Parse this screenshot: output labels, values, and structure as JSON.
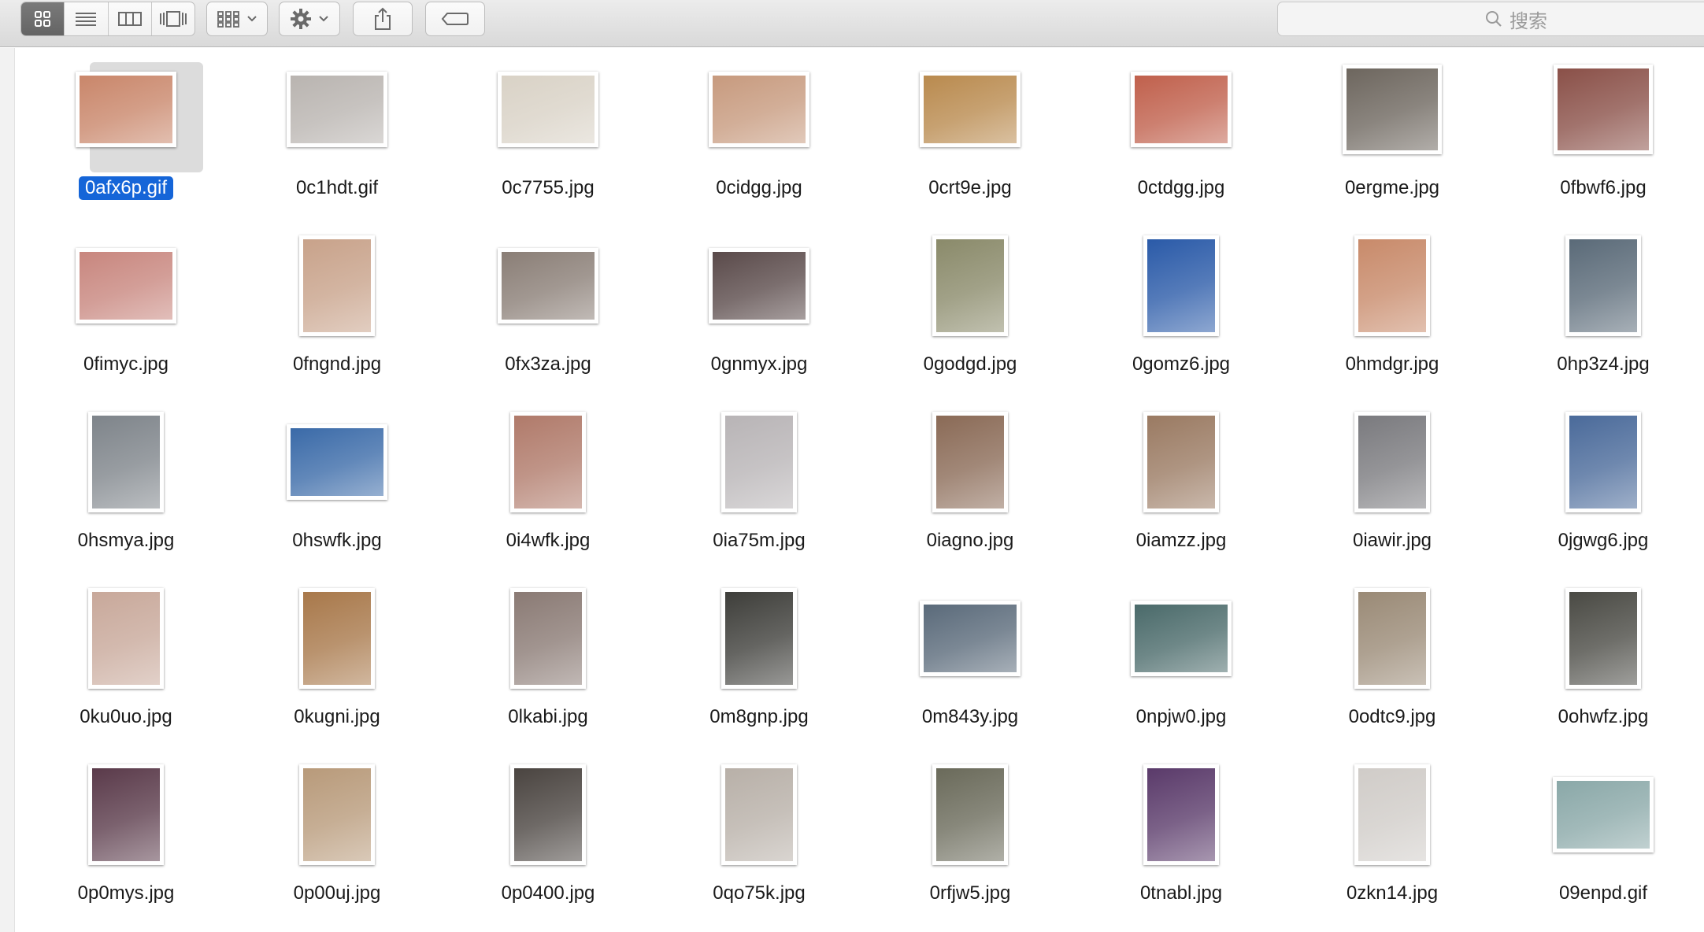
{
  "toolbar": {
    "view_modes": [
      {
        "icon": "icon-view-grid-icon",
        "active": true
      },
      {
        "icon": "list-view-icon",
        "active": false
      },
      {
        "icon": "column-view-icon",
        "active": false
      },
      {
        "icon": "cover-flow-icon",
        "active": false
      }
    ],
    "arrange_icon": "arrange-grid-icon",
    "action_icon": "gear-icon",
    "share_icon": "share-icon",
    "tag_icon": "tag-icon"
  },
  "search": {
    "placeholder": "搜索",
    "icon": "search-icon"
  },
  "colors": {
    "selection": "#1565d8",
    "toolbar": "#e2e2e2"
  },
  "files": [
    {
      "name": "0afx6p.gif",
      "selected": true,
      "shape": "landscape",
      "color": "#c9866a"
    },
    {
      "name": "0c1hdt.gif",
      "selected": false,
      "shape": "landscape",
      "color": "#b9b4b0"
    },
    {
      "name": "0c7755.jpg",
      "selected": false,
      "shape": "landscape",
      "color": "#d9d2c6"
    },
    {
      "name": "0cidgg.jpg",
      "selected": false,
      "shape": "landscape",
      "color": "#c79a7e"
    },
    {
      "name": "0crt9e.jpg",
      "selected": false,
      "shape": "landscape",
      "color": "#b98a4e"
    },
    {
      "name": "0ctdgg.jpg",
      "selected": false,
      "shape": "landscape",
      "color": "#c0604c"
    },
    {
      "name": "0ergme.jpg",
      "selected": false,
      "shape": "landscape-tall",
      "color": "#6d665e"
    },
    {
      "name": "0fbwf6.jpg",
      "selected": false,
      "shape": "landscape-tall",
      "color": "#8a5048"
    },
    {
      "name": "0fimyc.jpg",
      "selected": false,
      "shape": "landscape",
      "color": "#c8867e"
    },
    {
      "name": "0fngnd.jpg",
      "selected": false,
      "shape": "portrait",
      "color": "#c8a28a"
    },
    {
      "name": "0fx3za.jpg",
      "selected": false,
      "shape": "landscape",
      "color": "#8a7e76"
    },
    {
      "name": "0gnmyx.jpg",
      "selected": false,
      "shape": "landscape",
      "color": "#5a4a4a"
    },
    {
      "name": "0godgd.jpg",
      "selected": false,
      "shape": "portrait",
      "color": "#8a8a6a"
    },
    {
      "name": "0gomz6.jpg",
      "selected": false,
      "shape": "portrait",
      "color": "#2a5aa8"
    },
    {
      "name": "0hmdgr.jpg",
      "selected": false,
      "shape": "portrait",
      "color": "#c88a6a"
    },
    {
      "name": "0hp3z4.jpg",
      "selected": false,
      "shape": "portrait",
      "color": "#5a6a78"
    },
    {
      "name": "0hsmya.jpg",
      "selected": false,
      "shape": "portrait",
      "color": "#7e848a"
    },
    {
      "name": "0hswfk.jpg",
      "selected": false,
      "shape": "landscape",
      "color": "#3a6aa8"
    },
    {
      "name": "0i4wfk.jpg",
      "selected": false,
      "shape": "portrait",
      "color": "#b07a6a"
    },
    {
      "name": "0ia75m.jpg",
      "selected": false,
      "shape": "portrait",
      "color": "#b8b4b6"
    },
    {
      "name": "0iagno.jpg",
      "selected": false,
      "shape": "portrait",
      "color": "#8a6a56"
    },
    {
      "name": "0iamzz.jpg",
      "selected": false,
      "shape": "portrait",
      "color": "#9a7a62"
    },
    {
      "name": "0iawir.jpg",
      "selected": false,
      "shape": "portrait",
      "color": "#7a7a7e"
    },
    {
      "name": "0jgwg6.jpg",
      "selected": false,
      "shape": "portrait",
      "color": "#4a6a9a"
    },
    {
      "name": "0ku0uo.jpg",
      "selected": false,
      "shape": "portrait",
      "color": "#c8a89a"
    },
    {
      "name": "0kugni.jpg",
      "selected": false,
      "shape": "portrait",
      "color": "#a8784a"
    },
    {
      "name": "0lkabi.jpg",
      "selected": false,
      "shape": "portrait",
      "color": "#8a7a74"
    },
    {
      "name": "0m8gnp.jpg",
      "selected": false,
      "shape": "portrait",
      "color": "#3e3e3a"
    },
    {
      "name": "0m843y.jpg",
      "selected": false,
      "shape": "landscape",
      "color": "#5a6a7a"
    },
    {
      "name": "0npjw0.jpg",
      "selected": false,
      "shape": "landscape",
      "color": "#4a6a6a"
    },
    {
      "name": "0odtc9.jpg",
      "selected": false,
      "shape": "portrait",
      "color": "#9a8a76"
    },
    {
      "name": "0ohwfz.jpg",
      "selected": false,
      "shape": "portrait",
      "color": "#4a4a44"
    },
    {
      "name": "0p0mys.jpg",
      "selected": false,
      "shape": "portrait",
      "color": "#5a3a4a"
    },
    {
      "name": "0p00uj.jpg",
      "selected": false,
      "shape": "portrait",
      "color": "#b89a7a"
    },
    {
      "name": "0p0400.jpg",
      "selected": false,
      "shape": "portrait",
      "color": "#4a4440"
    },
    {
      "name": "0qo75k.jpg",
      "selected": false,
      "shape": "portrait",
      "color": "#b8b0a8"
    },
    {
      "name": "0rfjw5.jpg",
      "selected": false,
      "shape": "portrait",
      "color": "#6a6a5a"
    },
    {
      "name": "0tnabl.jpg",
      "selected": false,
      "shape": "portrait",
      "color": "#5a3a6a"
    },
    {
      "name": "0zkn14.jpg",
      "selected": false,
      "shape": "portrait",
      "color": "#d0ccc8"
    },
    {
      "name": "09enpd.gif",
      "selected": false,
      "shape": "landscape",
      "color": "#8aa8a8"
    }
  ]
}
